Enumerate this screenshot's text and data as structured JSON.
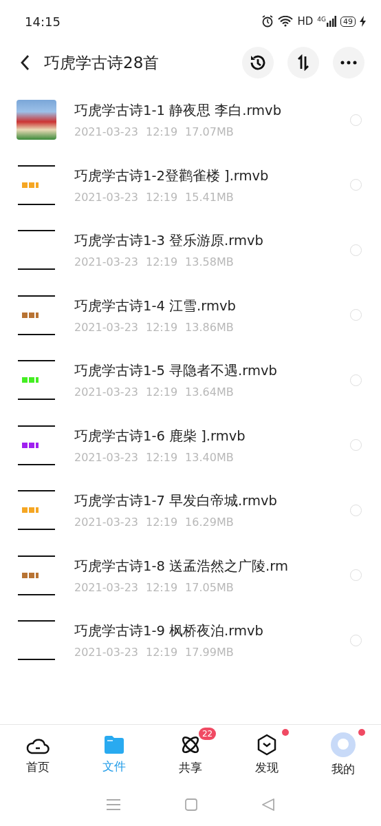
{
  "status_bar": {
    "time": "14:15",
    "network": "HD",
    "cell": "4G",
    "battery": "49"
  },
  "header": {
    "title": "巧虎学古诗28首"
  },
  "files": [
    {
      "name": "巧虎学古诗1-1 静夜思 李白.rmvb",
      "date": "2021-03-23",
      "time": "12:19",
      "size": "17.07MB",
      "kind": "photo",
      "selected": false
    },
    {
      "name": "巧虎学古诗1-2登鹳雀楼 ].rmvb",
      "date": "2021-03-23",
      "time": "12:19",
      "size": "15.41MB",
      "kind": "frame",
      "color": "#f5a623",
      "selected": false
    },
    {
      "name": "巧虎学古诗1-3 登乐游原.rmvb",
      "date": "2021-03-23",
      "time": "12:19",
      "size": "13.58MB",
      "kind": "blank",
      "selected": false
    },
    {
      "name": "巧虎学古诗1-4 江雪.rmvb",
      "date": "2021-03-23",
      "time": "12:19",
      "size": "13.86MB",
      "kind": "frame",
      "color": "#b87333",
      "selected": false
    },
    {
      "name": "巧虎学古诗1-5 寻隐者不遇.rmvb",
      "date": "2021-03-23",
      "time": "12:19",
      "size": "13.64MB",
      "kind": "frame",
      "color": "#44ee22",
      "selected": false
    },
    {
      "name": "巧虎学古诗1-6 鹿柴 ].rmvb",
      "date": "2021-03-23",
      "time": "12:19",
      "size": "13.40MB",
      "kind": "frame",
      "color": "#a020f0",
      "selected": false
    },
    {
      "name": "巧虎学古诗1-7 早发白帝城.rmvb",
      "date": "2021-03-23",
      "time": "12:19",
      "size": "16.29MB",
      "kind": "frame",
      "color": "#f5a623",
      "selected": false
    },
    {
      "name": "巧虎学古诗1-8 送孟浩然之广陵.rm",
      "date": "2021-03-23",
      "time": "12:19",
      "size": "17.05MB",
      "kind": "frame",
      "color": "#b87333",
      "selected": false
    },
    {
      "name": "巧虎学古诗1-9 枫桥夜泊.rmvb",
      "date": "2021-03-23",
      "time": "12:19",
      "size": "17.99MB",
      "kind": "blank",
      "selected": false
    }
  ],
  "tabs": [
    {
      "label": "首页",
      "kind": "home",
      "selected": false
    },
    {
      "label": "文件",
      "kind": "files",
      "selected": true
    },
    {
      "label": "共享",
      "kind": "share",
      "selected": false,
      "badge": "22"
    },
    {
      "label": "发现",
      "kind": "discover",
      "selected": false,
      "dot": true
    },
    {
      "label": "我的",
      "kind": "me",
      "selected": false,
      "dot": true
    }
  ]
}
